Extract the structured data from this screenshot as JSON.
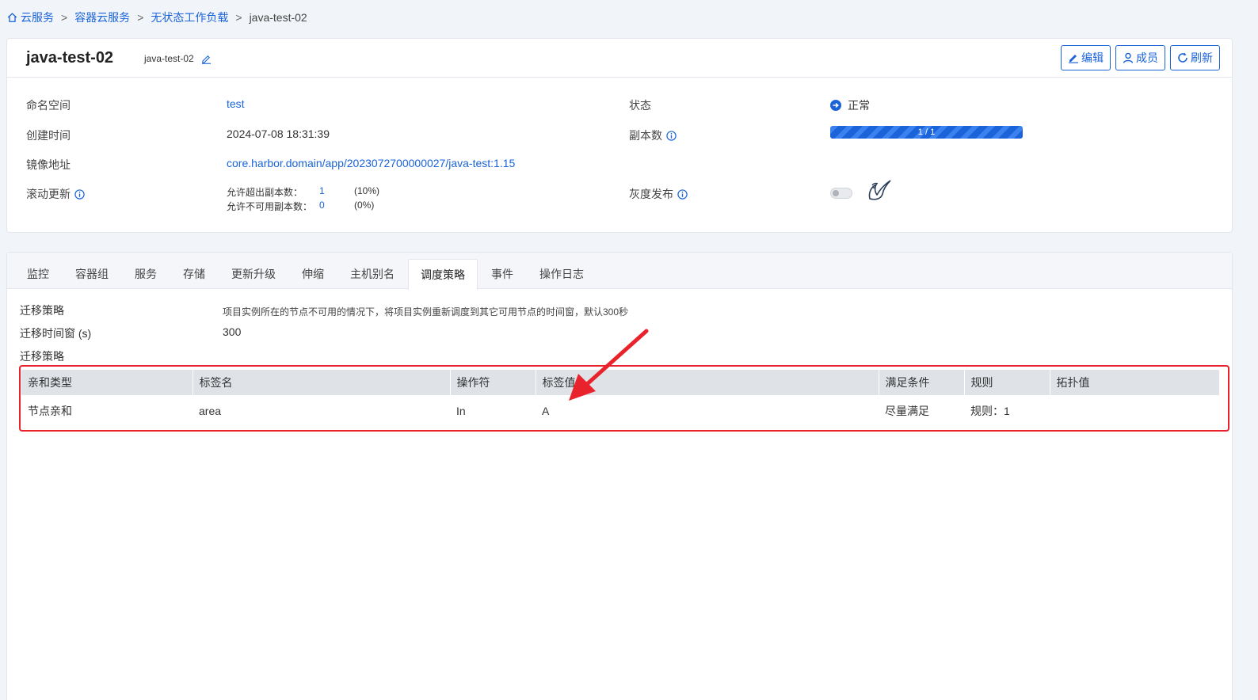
{
  "breadcrumb": {
    "items": [
      "云服务",
      "容器云服务",
      "无状态工作负载"
    ],
    "current": "java-test-02",
    "separator": ">"
  },
  "header": {
    "title": "java-test-02",
    "subtitle": "java-test-02",
    "buttons": {
      "edit": "编辑",
      "members": "成员",
      "refresh": "刷新"
    }
  },
  "details": {
    "namespace_label": "命名空间",
    "namespace_value": "test",
    "created_label": "创建时间",
    "created_value": "2024-07-08 18:31:39",
    "image_label": "镜像地址",
    "image_value": "core.harbor.domain/app/2023072700000027/java-test:1.15",
    "rolling_label": "滚动更新",
    "surge_label": "允许超出副本数：",
    "surge_value": "1",
    "surge_pct": "(10%)",
    "unavail_label": "允许不可用副本数：",
    "unavail_value": "0",
    "unavail_pct": "(0%)",
    "status_label": "状态",
    "status_value": "正常",
    "replicas_label": "副本数",
    "replicas_text": "1 / 1",
    "replicas_fraction": 1.0,
    "canary_label": "灰度发布",
    "canary_enabled": false
  },
  "tabs": [
    "监控",
    "容器组",
    "服务",
    "存储",
    "更新升级",
    "伸缩",
    "主机别名",
    "调度策略",
    "事件",
    "操作日志"
  ],
  "active_tab": "调度策略",
  "schedule": {
    "migration_label": "迁移策略",
    "migration_desc": "项目实例所在的节点不可用的情况下，将项目实例重新调度到其它可用节点的时间窗，默认300秒",
    "window_label": "迁移时间窗 (s)",
    "window_value": "300",
    "policy_label": "迁移策略",
    "table": {
      "headers": [
        "亲和类型",
        "标签名",
        "操作符",
        "标签值",
        "满足条件",
        "规则",
        "拓扑值"
      ],
      "rows": [
        [
          "节点亲和",
          "area",
          "In",
          "A",
          "尽量满足",
          "规则：1",
          ""
        ]
      ]
    }
  },
  "colors": {
    "accent": "#1a63d8",
    "highlight": "#e8232b"
  }
}
